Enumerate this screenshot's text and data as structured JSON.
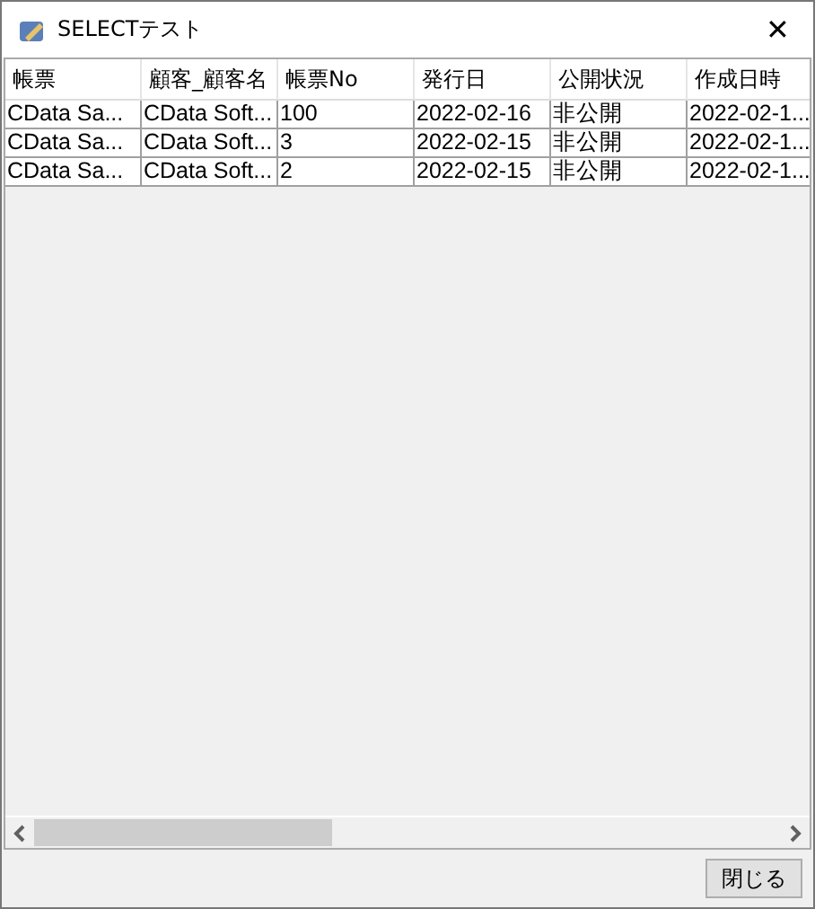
{
  "window": {
    "title": "SELECTテスト",
    "close": "✕"
  },
  "table": {
    "columns": [
      "帳票",
      "顧客_顧客名",
      "帳票No",
      "発行日",
      "公開状況",
      "作成日時"
    ],
    "rows": [
      [
        "CData Sa...",
        "CData Soft...",
        "100",
        "2022-02-16",
        "非公開",
        "2022-02-1..."
      ],
      [
        "CData Sa...",
        "CData Soft...",
        "3",
        "2022-02-15",
        "非公開",
        "2022-02-1..."
      ],
      [
        "CData Sa...",
        "CData Soft...",
        "2",
        "2022-02-15",
        "非公開",
        "2022-02-1..."
      ]
    ]
  },
  "buttons": [
    "閉じる"
  ]
}
